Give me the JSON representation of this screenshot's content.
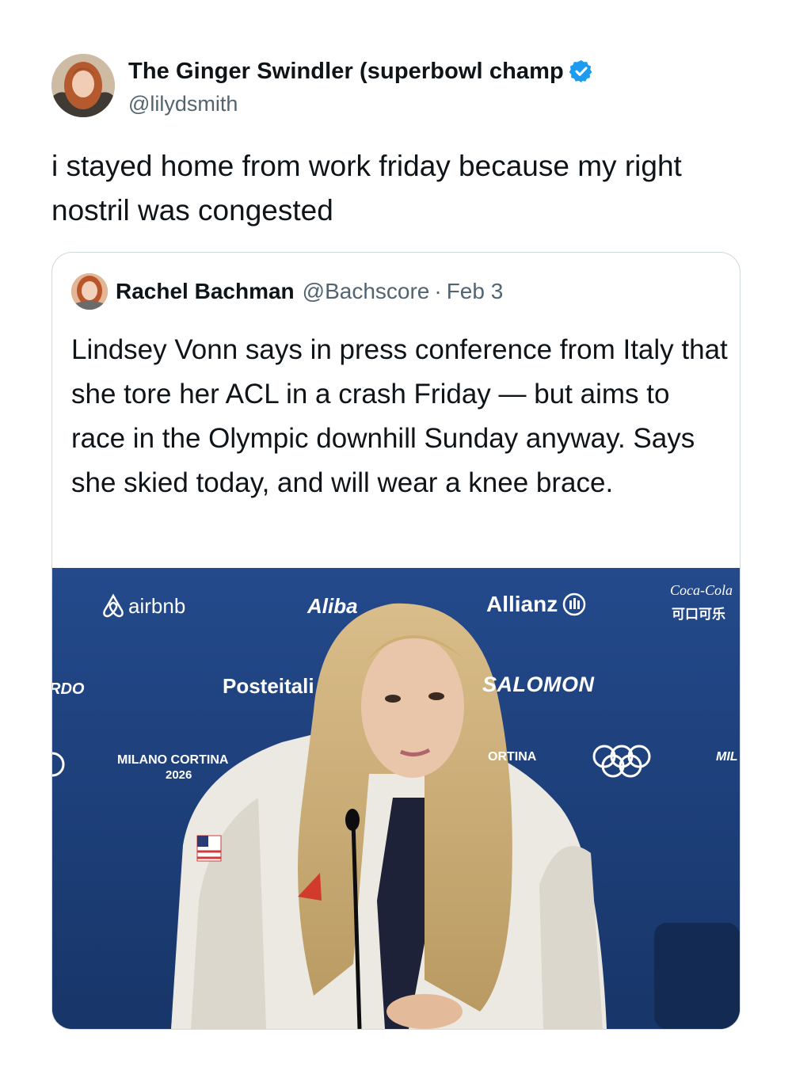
{
  "author": {
    "display_name": "The Ginger Swindler (superbowl champ",
    "handle": "@lilydsmith",
    "verified_icon": "verified-badge-icon"
  },
  "tweet": {
    "text": "i stayed home from work friday because my right nostril was congested"
  },
  "quoted": {
    "display_name": "Rachel Bachman",
    "handle": "@Bachscore",
    "separator": "·",
    "date": "Feb 3",
    "text": "Lindsey Vonn says in press conference from Italy that she tore her ACL in a crash Friday — but aims to race in the Olympic downhill Sunday anyway. Says she skied today, and will wear a knee brace."
  },
  "media": {
    "sponsors": {
      "airbnb": "airbnb",
      "alibaba": "Aliba",
      "allianz": "Allianz",
      "cocacola": "Coca-Cola",
      "cocacola_cn": "可口可乐",
      "ardo": "RDO",
      "poste": "Posteitali",
      "salomon": "SALOMON",
      "milano_cortina": "MILANO CORTINA",
      "year": "2026",
      "cortina": "ORTINA",
      "mil": "MIL"
    }
  },
  "colors": {
    "text_primary": "#0f1419",
    "text_secondary": "#536471",
    "verified_blue": "#1d9bf0",
    "border": "#cfd9de",
    "backdrop_blue": "#1d3f7d"
  }
}
